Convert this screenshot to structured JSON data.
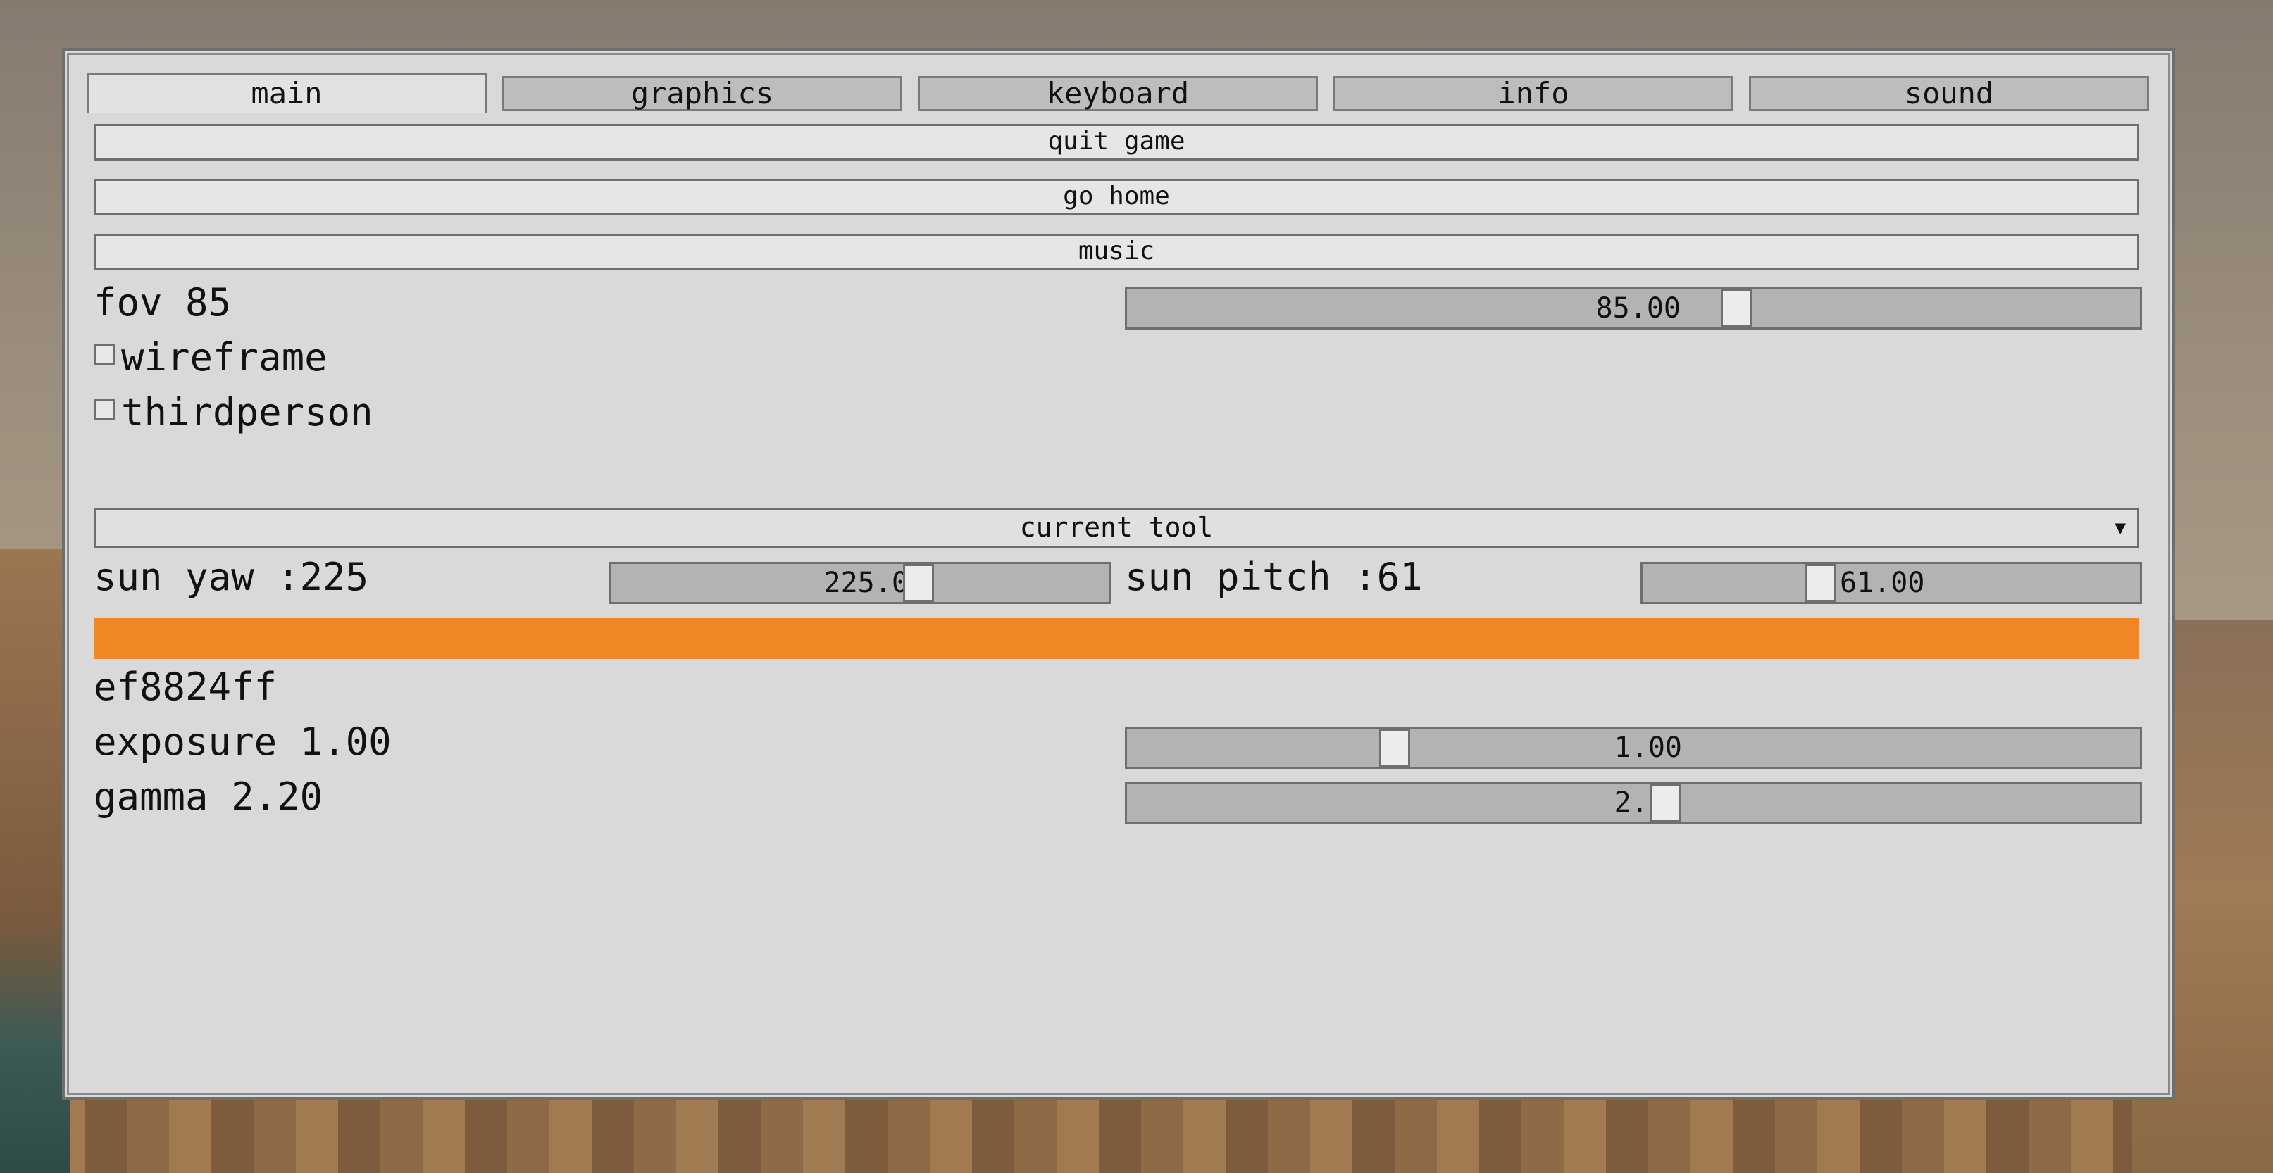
{
  "tabs": [
    {
      "label": "main"
    },
    {
      "label": "graphics"
    },
    {
      "label": "keyboard"
    },
    {
      "label": "info"
    },
    {
      "label": "sound"
    }
  ],
  "buttons": {
    "quit": "quit game",
    "home": "go home",
    "music": "music"
  },
  "fov": {
    "label": "fov 85",
    "value": "85.00",
    "fraction": 0.605
  },
  "checkboxes": [
    {
      "label": "wireframe",
      "checked": false
    },
    {
      "label": "thirdperson",
      "checked": false
    }
  ],
  "tool_dropdown": {
    "label": "current tool",
    "arrow": "▼"
  },
  "sun_yaw": {
    "label": "sun yaw :225",
    "value": "225.00",
    "fraction": 0.625
  },
  "sun_pitch": {
    "label": "sun pitch :61",
    "value": "61.00",
    "fraction": 0.349
  },
  "color": {
    "hex": "ef8824ff",
    "swatch": "#ef8824"
  },
  "exposure": {
    "label": "exposure 1.00",
    "value": "1.00",
    "fraction": 0.257
  },
  "gamma": {
    "label": "gamma 2.20",
    "value": "2.20",
    "fraction": 0.533
  }
}
